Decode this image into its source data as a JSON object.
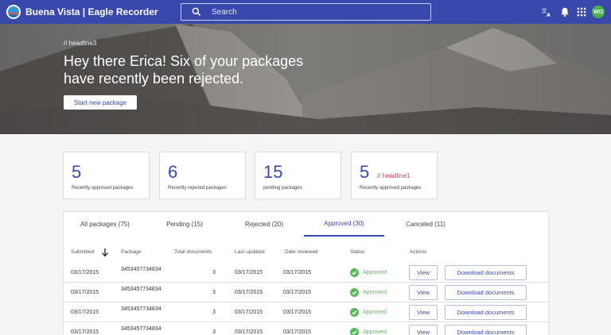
{
  "header": {
    "app_title": "Buena Vista | Eagle Recorder",
    "search_placeholder": "Search",
    "avatar_initials": "WO",
    "color": "#3948ab"
  },
  "hero": {
    "kicker": "// headline3",
    "headline_line1": "Hey there Erica! Six of your packages",
    "headline_line2": "have recently been rejected.",
    "cta_label": "Start new package"
  },
  "stats": [
    {
      "value": "5",
      "label": "Recently approved packages",
      "tag": ""
    },
    {
      "value": "6",
      "label": "Recently rejected packages",
      "tag": ""
    },
    {
      "value": "15",
      "label": "pending packages",
      "tag": ""
    },
    {
      "value": "5",
      "label": "Recently approved packages",
      "tag": "// headline1"
    }
  ],
  "tabs": [
    {
      "label": "All packages (75)",
      "active": false
    },
    {
      "label": "Pending (15)",
      "active": false
    },
    {
      "label": "Rejected (20)",
      "active": false
    },
    {
      "label": "Approved (30)",
      "active": true
    },
    {
      "label": "Canceled (11)",
      "active": false
    }
  ],
  "table": {
    "headers": {
      "submitted": "Submitted",
      "package": "Package",
      "total_documents": "Total documents",
      "last_updated": "Last updated",
      "date_reviewed": "Date reviewed",
      "status": "Status",
      "actions": "Actions"
    },
    "rows": [
      {
        "submitted": "03/17/2015",
        "package": "3453457734834",
        "total": "3",
        "updated": "03/17/2015",
        "reviewed": "03/17/2015",
        "status": "Approved",
        "view": "View",
        "download": "Download documents"
      },
      {
        "submitted": "03/17/2015",
        "package": "3453457734834",
        "total": "3",
        "updated": "03/17/2015",
        "reviewed": "03/17/2015",
        "status": "Approved",
        "view": "View",
        "download": "Download documents"
      },
      {
        "submitted": "03/17/2015",
        "package": "3453457734834",
        "total": "3",
        "updated": "03/17/2015",
        "reviewed": "03/17/2015",
        "status": "Approved",
        "view": "View",
        "download": "Download documents"
      },
      {
        "submitted": "03/17/2015",
        "package": "3453457734834",
        "total": "3",
        "updated": "03/17/2015",
        "reviewed": "03/17/2015",
        "status": "Approved",
        "view": "View",
        "download": "Download documents"
      }
    ]
  },
  "icons": {
    "logo": "buena-vista-logo",
    "search": "search-icon",
    "translate": "translate-icon",
    "notifications": "bell-icon",
    "apps": "apps-grid-icon",
    "sort": "arrow-down-icon",
    "status": "check-circle-icon"
  },
  "colors": {
    "primary": "#3948ab",
    "approved": "#5cb85c",
    "accent_tag": "#e2336b"
  }
}
